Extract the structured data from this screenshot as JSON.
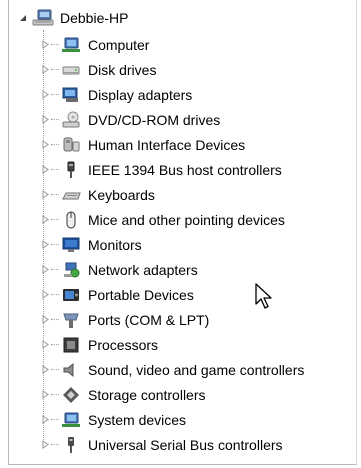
{
  "tree": {
    "root": {
      "label": "Debbie-HP",
      "icon": "computer-network-icon",
      "expanded": true
    },
    "items": [
      {
        "label": "Computer",
        "icon": "computer-icon"
      },
      {
        "label": "Disk drives",
        "icon": "disk-drive-icon"
      },
      {
        "label": "Display adapters",
        "icon": "display-adapter-icon"
      },
      {
        "label": "DVD/CD-ROM drives",
        "icon": "dvd-drive-icon"
      },
      {
        "label": "Human Interface Devices",
        "icon": "hid-icon"
      },
      {
        "label": "IEEE 1394 Bus host controllers",
        "icon": "ieee1394-icon"
      },
      {
        "label": "Keyboards",
        "icon": "keyboard-icon"
      },
      {
        "label": "Mice and other pointing devices",
        "icon": "mouse-icon"
      },
      {
        "label": "Monitors",
        "icon": "monitor-icon"
      },
      {
        "label": "Network adapters",
        "icon": "network-adapter-icon"
      },
      {
        "label": "Portable Devices",
        "icon": "portable-device-icon"
      },
      {
        "label": "Ports (COM & LPT)",
        "icon": "port-icon"
      },
      {
        "label": "Processors",
        "icon": "processor-icon"
      },
      {
        "label": "Sound, video and game controllers",
        "icon": "sound-icon"
      },
      {
        "label": "Storage controllers",
        "icon": "storage-controller-icon"
      },
      {
        "label": "System devices",
        "icon": "system-devices-icon"
      },
      {
        "label": "Universal Serial Bus controllers",
        "icon": "usb-icon"
      }
    ]
  }
}
